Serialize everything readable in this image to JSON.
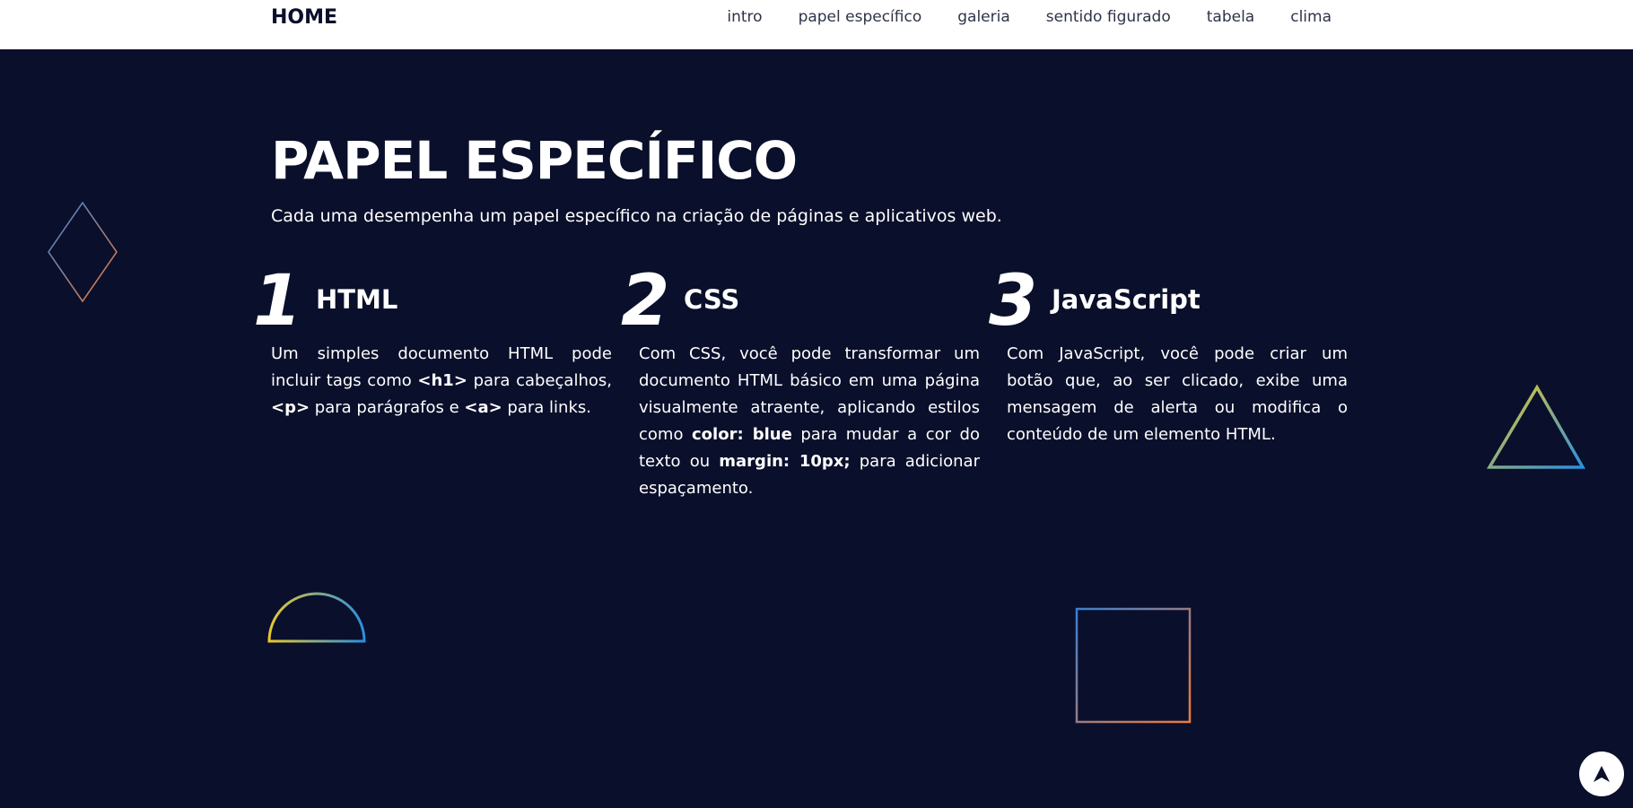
{
  "nav": {
    "brand": "HOME",
    "links": [
      "intro",
      "papel específico",
      "galeria",
      "sentido figurado",
      "tabela",
      "clima"
    ]
  },
  "hero": {
    "title": "PAPEL ESPECÍFICO",
    "subtitle": "Cada uma desempenha um papel específico na criação de páginas e aplicativos web."
  },
  "columns": [
    {
      "number": "1",
      "title": "HTML",
      "text": [
        "Um simples documento HTML pode incluir tags como ",
        "<h1>",
        " para cabeçalhos, ",
        "<p>",
        " para parágrafos e ",
        "<a>",
        " para links."
      ]
    },
    {
      "number": "2",
      "title": "CSS",
      "text": [
        "Com CSS, você pode transformar um documento HTML básico em uma página visualmente atraente, aplicando estilos como ",
        "color: blue",
        " para mudar a cor do texto ou ",
        "margin: 10px;",
        " para adicionar espaçamento."
      ]
    },
    {
      "number": "3",
      "title": "JavaScript",
      "text": [
        "Com JavaScript, você pode criar um botão que, ao ser clicado, exibe uma mensagem de alerta ou modifica o conteúdo de um elemento HTML."
      ]
    }
  ],
  "colors": {
    "background": "#0a0f2b",
    "navbar": "#ffffff",
    "gradient_yellow": "#e8c92d",
    "gradient_blue": "#2a8fe0",
    "gradient_orange": "#f07a3a",
    "gradient_steel": "#3b7fd0"
  },
  "icons": {
    "back_to_top": "arrow-up-icon"
  }
}
